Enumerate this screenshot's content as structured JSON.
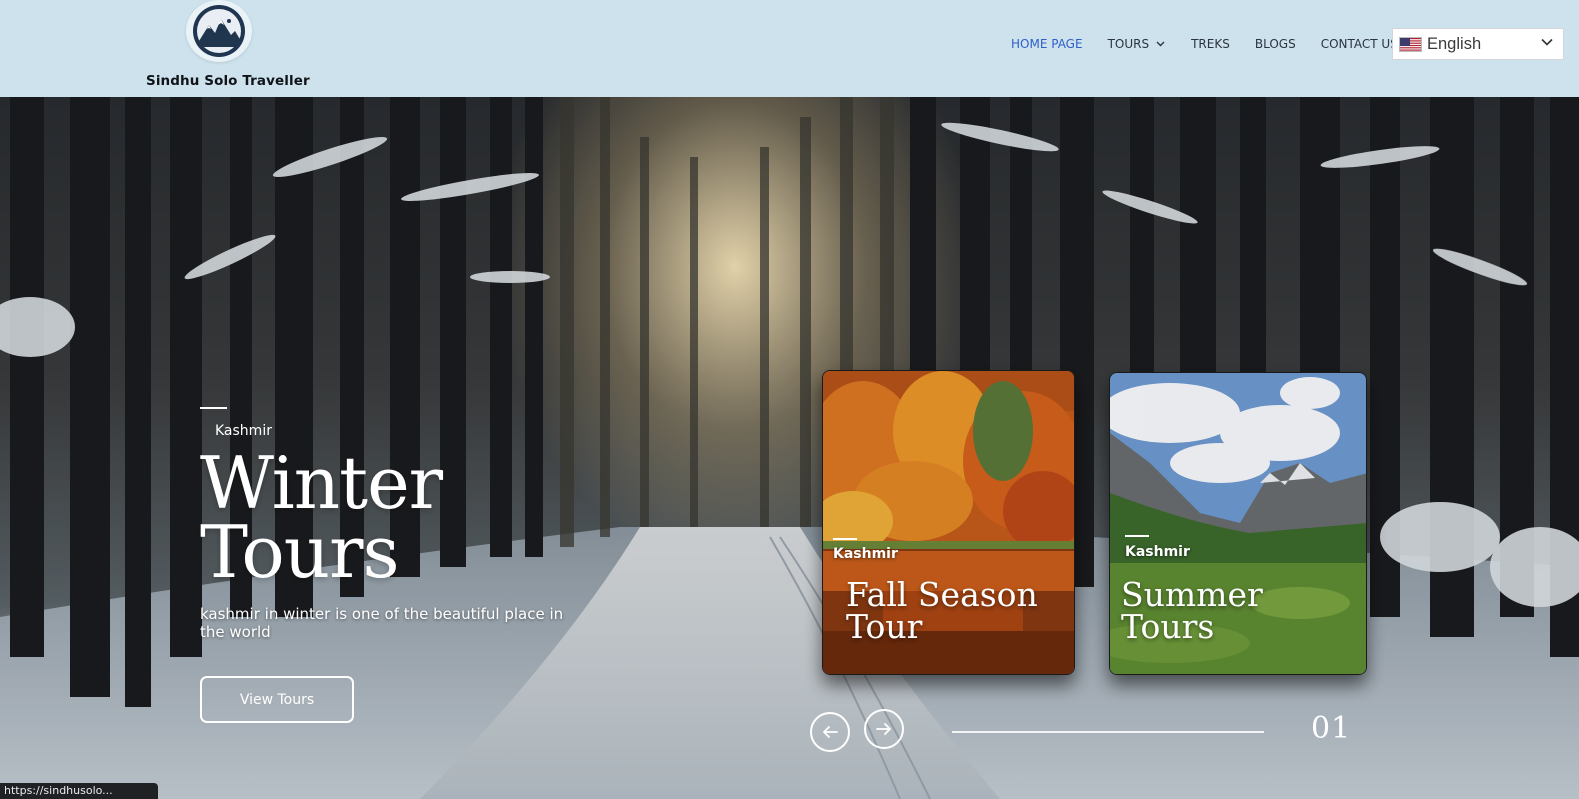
{
  "header": {
    "brand": "Sindhu Solo Traveller",
    "nav": {
      "home": "HOME PAGE",
      "tours": "TOURS",
      "treks": "TREKS",
      "blogs": "BLOGS",
      "contact": "CONTACT US"
    },
    "language": {
      "selected": "English",
      "flag_icon": "us-flag-icon"
    },
    "colors": {
      "background": "#cde2ec",
      "nav_active": "#2f60c8",
      "nav_text": "#2b3440"
    }
  },
  "hero": {
    "eyebrow": "Kashmir",
    "title_line1": "Winter",
    "title_line2": "Tours",
    "description": "kashmir in winter is one of the beautiful place in the world",
    "cta_label": "View Tours"
  },
  "cards": [
    {
      "eyebrow": "Kashmir",
      "title_line1": "Fall Season",
      "title_line2": "Tour"
    },
    {
      "eyebrow": "Kashmir",
      "title_line1": "Summer",
      "title_line2": "Tours"
    }
  ],
  "slider": {
    "current": "01",
    "prev_icon": "arrow-left-icon",
    "next_icon": "arrow-right-icon"
  },
  "status_bar": {
    "url_text": "https://sindhusolo..."
  }
}
